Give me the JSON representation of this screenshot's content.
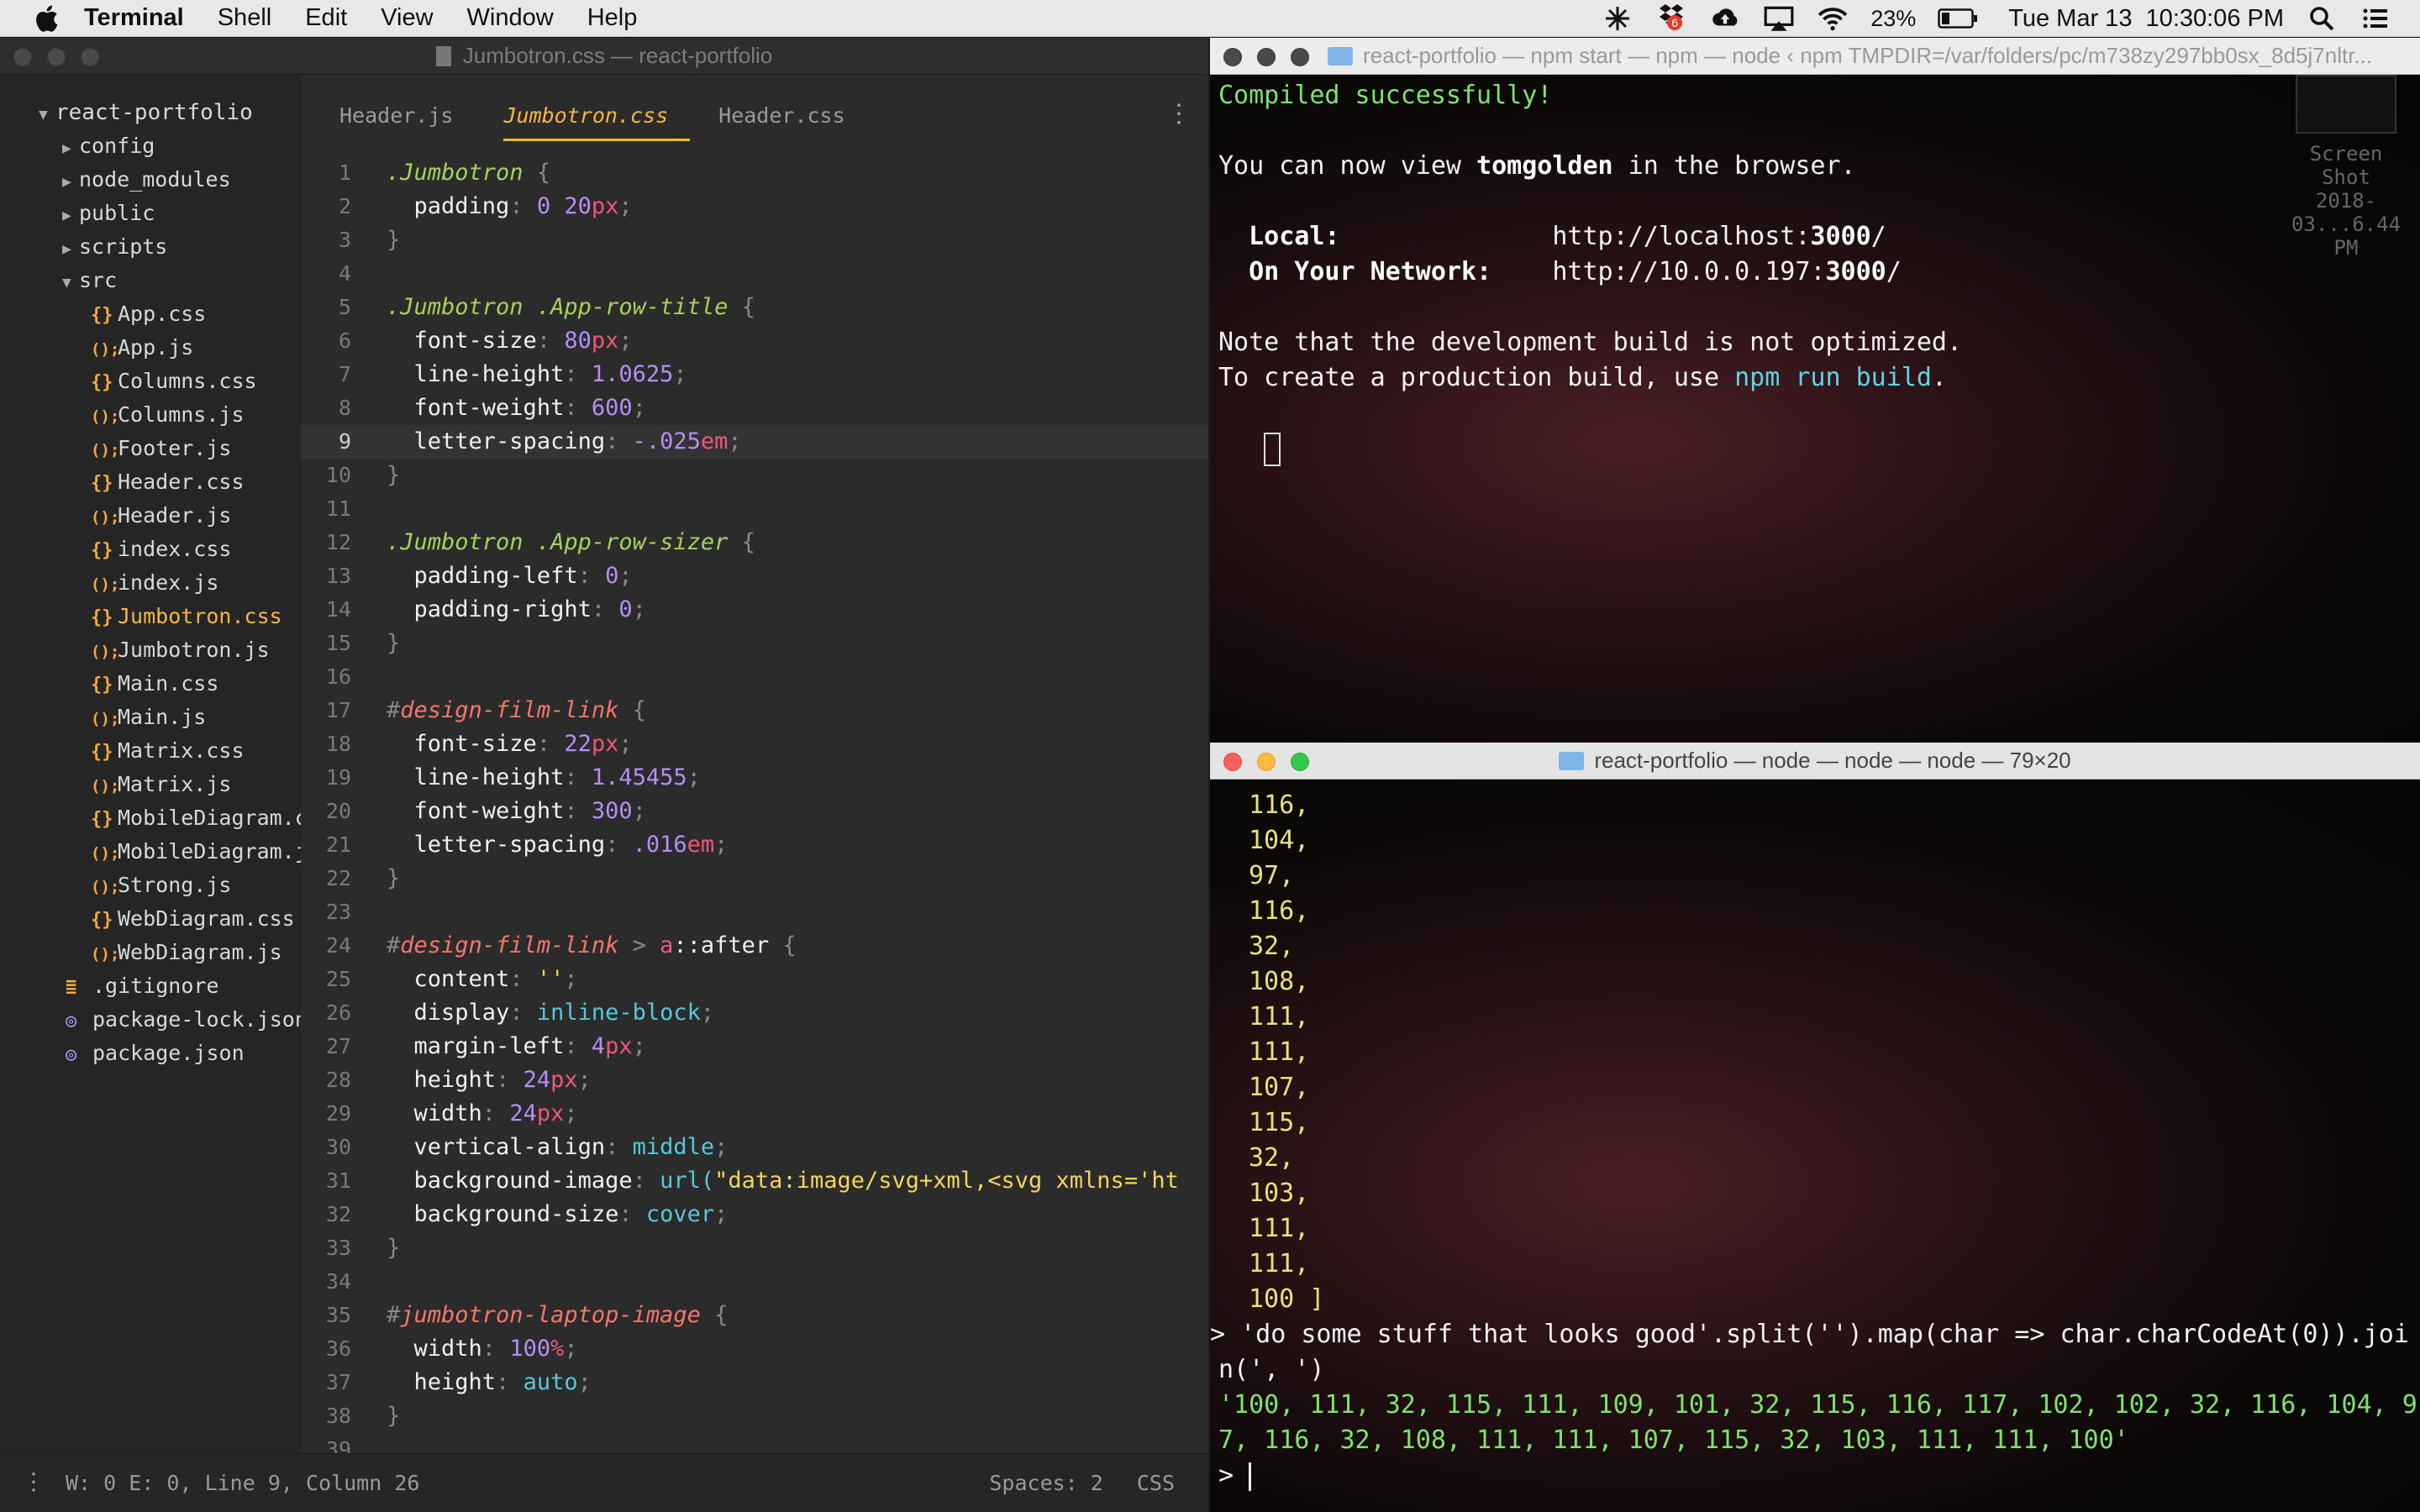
{
  "menubar": {
    "app": "Terminal",
    "items": [
      "Shell",
      "Edit",
      "View",
      "Window",
      "Help"
    ],
    "battery": "23%",
    "datetime": "Tue Mar 13  10:30:06 PM",
    "dropbox_badge": "6"
  },
  "editor": {
    "title": "Jumbotron.css — react-portfolio",
    "tabs": [
      "Header.js",
      "Jumbotron.css",
      "Header.css"
    ],
    "active_tab": 1,
    "tree": [
      {
        "label": "react-portfolio",
        "depth": 0,
        "kind": "folder-open"
      },
      {
        "label": "config",
        "depth": 1,
        "kind": "folder"
      },
      {
        "label": "node_modules",
        "depth": 1,
        "kind": "folder"
      },
      {
        "label": "public",
        "depth": 1,
        "kind": "folder"
      },
      {
        "label": "scripts",
        "depth": 1,
        "kind": "folder"
      },
      {
        "label": "src",
        "depth": 1,
        "kind": "folder-open"
      },
      {
        "label": "App.css",
        "depth": 2,
        "kind": "css"
      },
      {
        "label": "App.js",
        "depth": 2,
        "kind": "js"
      },
      {
        "label": "Columns.css",
        "depth": 2,
        "kind": "css"
      },
      {
        "label": "Columns.js",
        "depth": 2,
        "kind": "js"
      },
      {
        "label": "Footer.js",
        "depth": 2,
        "kind": "js"
      },
      {
        "label": "Header.css",
        "depth": 2,
        "kind": "css"
      },
      {
        "label": "Header.js",
        "depth": 2,
        "kind": "js"
      },
      {
        "label": "index.css",
        "depth": 2,
        "kind": "css"
      },
      {
        "label": "index.js",
        "depth": 2,
        "kind": "js"
      },
      {
        "label": "Jumbotron.css",
        "depth": 2,
        "kind": "css",
        "active": true
      },
      {
        "label": "Jumbotron.js",
        "depth": 2,
        "kind": "js"
      },
      {
        "label": "Main.css",
        "depth": 2,
        "kind": "css"
      },
      {
        "label": "Main.js",
        "depth": 2,
        "kind": "js"
      },
      {
        "label": "Matrix.css",
        "depth": 2,
        "kind": "css"
      },
      {
        "label": "Matrix.js",
        "depth": 2,
        "kind": "js"
      },
      {
        "label": "MobileDiagram.css",
        "depth": 2,
        "kind": "css"
      },
      {
        "label": "MobileDiagram.js",
        "depth": 2,
        "kind": "js"
      },
      {
        "label": "Strong.js",
        "depth": 2,
        "kind": "js"
      },
      {
        "label": "WebDiagram.css",
        "depth": 2,
        "kind": "css"
      },
      {
        "label": "WebDiagram.js",
        "depth": 2,
        "kind": "js"
      },
      {
        "label": ".gitignore",
        "depth": 1,
        "kind": "text"
      },
      {
        "label": "package-lock.json",
        "depth": 1,
        "kind": "json"
      },
      {
        "label": "package.json",
        "depth": 1,
        "kind": "json"
      }
    ],
    "current_line": 9,
    "code": [
      [
        [
          "sel",
          ".Jumbotron"
        ],
        [
          "br",
          " {"
        ]
      ],
      [
        [
          "dot",
          "  "
        ],
        [
          "prop",
          "padding"
        ],
        [
          "br",
          ": "
        ],
        [
          "num",
          "0"
        ],
        [
          "br",
          " "
        ],
        [
          "num",
          "20"
        ],
        [
          "unit",
          "px"
        ],
        [
          "br",
          ";"
        ]
      ],
      [
        [
          "br",
          "}"
        ]
      ],
      [],
      [
        [
          "sel",
          ".Jumbotron .App-row-title"
        ],
        [
          "br",
          " {"
        ]
      ],
      [
        [
          "dot",
          "  "
        ],
        [
          "prop",
          "font-size"
        ],
        [
          "br",
          ": "
        ],
        [
          "num",
          "80"
        ],
        [
          "unit",
          "px"
        ],
        [
          "br",
          ";"
        ]
      ],
      [
        [
          "dot",
          "  "
        ],
        [
          "prop",
          "line-height"
        ],
        [
          "br",
          ": "
        ],
        [
          "num",
          "1.0625"
        ],
        [
          "br",
          ";"
        ]
      ],
      [
        [
          "dot",
          "  "
        ],
        [
          "prop",
          "font-weight"
        ],
        [
          "br",
          ": "
        ],
        [
          "num",
          "600"
        ],
        [
          "br",
          ";"
        ]
      ],
      [
        [
          "dot",
          "  "
        ],
        [
          "prop",
          "letter-spacing"
        ],
        [
          "br",
          ": "
        ],
        [
          "num",
          "-.025"
        ],
        [
          "unit",
          "em"
        ],
        [
          "br",
          ";"
        ]
      ],
      [
        [
          "br",
          "}"
        ]
      ],
      [],
      [
        [
          "sel",
          ".Jumbotron .App-row-sizer"
        ],
        [
          "br",
          " {"
        ]
      ],
      [
        [
          "dot",
          "  "
        ],
        [
          "prop",
          "padding-left"
        ],
        [
          "br",
          ": "
        ],
        [
          "num",
          "0"
        ],
        [
          "br",
          ";"
        ]
      ],
      [
        [
          "dot",
          "  "
        ],
        [
          "prop",
          "padding-right"
        ],
        [
          "br",
          ": "
        ],
        [
          "num",
          "0"
        ],
        [
          "br",
          ";"
        ]
      ],
      [
        [
          "br",
          "}"
        ]
      ],
      [],
      [
        [
          "br",
          "#"
        ],
        [
          "id",
          "design-film-link"
        ],
        [
          "br",
          " {"
        ]
      ],
      [
        [
          "dot",
          "  "
        ],
        [
          "prop",
          "font-size"
        ],
        [
          "br",
          ": "
        ],
        [
          "num",
          "22"
        ],
        [
          "unit",
          "px"
        ],
        [
          "br",
          ";"
        ]
      ],
      [
        [
          "dot",
          "  "
        ],
        [
          "prop",
          "line-height"
        ],
        [
          "br",
          ": "
        ],
        [
          "num",
          "1.45455"
        ],
        [
          "br",
          ";"
        ]
      ],
      [
        [
          "dot",
          "  "
        ],
        [
          "prop",
          "font-weight"
        ],
        [
          "br",
          ": "
        ],
        [
          "num",
          "300"
        ],
        [
          "br",
          ";"
        ]
      ],
      [
        [
          "dot",
          "  "
        ],
        [
          "prop",
          "letter-spacing"
        ],
        [
          "br",
          ": "
        ],
        [
          "num",
          ".016"
        ],
        [
          "unit",
          "em"
        ],
        [
          "br",
          ";"
        ]
      ],
      [
        [
          "br",
          "}"
        ]
      ],
      [],
      [
        [
          "br",
          "#"
        ],
        [
          "id",
          "design-film-link"
        ],
        [
          "br",
          " > "
        ],
        [
          "unit",
          "a"
        ],
        [
          "prop",
          "::after"
        ],
        [
          "br",
          " {"
        ]
      ],
      [
        [
          "dot",
          "  "
        ],
        [
          "prop",
          "content"
        ],
        [
          "br",
          ": "
        ],
        [
          "str",
          "''"
        ],
        [
          "br",
          ";"
        ]
      ],
      [
        [
          "dot",
          "  "
        ],
        [
          "prop",
          "display"
        ],
        [
          "br",
          ": "
        ],
        [
          "kw",
          "inline-block"
        ],
        [
          "br",
          ";"
        ]
      ],
      [
        [
          "dot",
          "  "
        ],
        [
          "prop",
          "margin-left"
        ],
        [
          "br",
          ": "
        ],
        [
          "num",
          "4"
        ],
        [
          "unit",
          "px"
        ],
        [
          "br",
          ";"
        ]
      ],
      [
        [
          "dot",
          "  "
        ],
        [
          "prop",
          "height"
        ],
        [
          "br",
          ": "
        ],
        [
          "num",
          "24"
        ],
        [
          "unit",
          "px"
        ],
        [
          "br",
          ";"
        ]
      ],
      [
        [
          "dot",
          "  "
        ],
        [
          "prop",
          "width"
        ],
        [
          "br",
          ": "
        ],
        [
          "num",
          "24"
        ],
        [
          "unit",
          "px"
        ],
        [
          "br",
          ";"
        ]
      ],
      [
        [
          "dot",
          "  "
        ],
        [
          "prop",
          "vertical-align"
        ],
        [
          "br",
          ": "
        ],
        [
          "kw",
          "middle"
        ],
        [
          "br",
          ";"
        ]
      ],
      [
        [
          "dot",
          "  "
        ],
        [
          "prop",
          "background-image"
        ],
        [
          "br",
          ": "
        ],
        [
          "kw",
          "url("
        ],
        [
          "str",
          "\"data:image/svg+xml,<svg xmlns='ht"
        ]
      ],
      [
        [
          "dot",
          "  "
        ],
        [
          "prop",
          "background-size"
        ],
        [
          "br",
          ": "
        ],
        [
          "kw",
          "cover"
        ],
        [
          "br",
          ";"
        ]
      ],
      [
        [
          "br",
          "}"
        ]
      ],
      [],
      [
        [
          "br",
          "#"
        ],
        [
          "id",
          "jumbotron-laptop-image"
        ],
        [
          "br",
          " {"
        ]
      ],
      [
        [
          "dot",
          "  "
        ],
        [
          "prop",
          "width"
        ],
        [
          "br",
          ": "
        ],
        [
          "num",
          "100"
        ],
        [
          "unit",
          "%"
        ],
        [
          "br",
          ";"
        ]
      ],
      [
        [
          "dot",
          "  "
        ],
        [
          "prop",
          "height"
        ],
        [
          "br",
          ": "
        ],
        [
          "kw",
          "auto"
        ],
        [
          "br",
          ";"
        ]
      ],
      [
        [
          "br",
          "}"
        ]
      ],
      []
    ],
    "status_left": "W: 0 E: 0, Line 9, Column 26",
    "status_spaces": "Spaces: 2",
    "status_lang": "CSS"
  },
  "term1": {
    "title": "react-portfolio — npm start — npm — node ‹ npm TMPDIR=/var/folders/pc/m738zy297bb0sx_8d5j7nltr...",
    "compiled": "Compiled successfully!",
    "view_pre": "You can now view ",
    "view_app": "tomgolden",
    "view_post": " in the browser.",
    "local_label": "Local:",
    "local_url_pre": "http://localhost:",
    "local_port": "3000",
    "local_url_post": "/",
    "net_label": "On Your Network:",
    "net_url_pre": "http://10.0.0.197:",
    "net_port": "3000",
    "net_url_post": "/",
    "note1": "Note that the development build is not optimized.",
    "note2_pre": "To create a production build, use ",
    "note2_cmd": "npm run build",
    "note2_post": ".",
    "screenshot_label1": "Screen Shot",
    "screenshot_label2": "2018-03...6.44 PM"
  },
  "term2": {
    "title": "react-portfolio — node — node — node — 79×20",
    "values": [
      "116,",
      "104,",
      "97,",
      "116,",
      "32,",
      "108,",
      "111,",
      "111,",
      "107,",
      "115,",
      "32,",
      "103,",
      "111,",
      "111,",
      "100 ]"
    ],
    "cmd1": "> 'do some stuff that looks good'.split('').map(char => char.charCodeAt(0)).joi",
    "cmd2": "n(', ')",
    "out1": "'100, 111, 32, 115, 111, 109, 101, 32, 115, 116, 117, 102, 102, 32, 116, 104, 9",
    "out2": "7, 116, 32, 108, 111, 111, 107, 115, 32, 103, 111, 111, 100'",
    "prompt": "> "
  }
}
